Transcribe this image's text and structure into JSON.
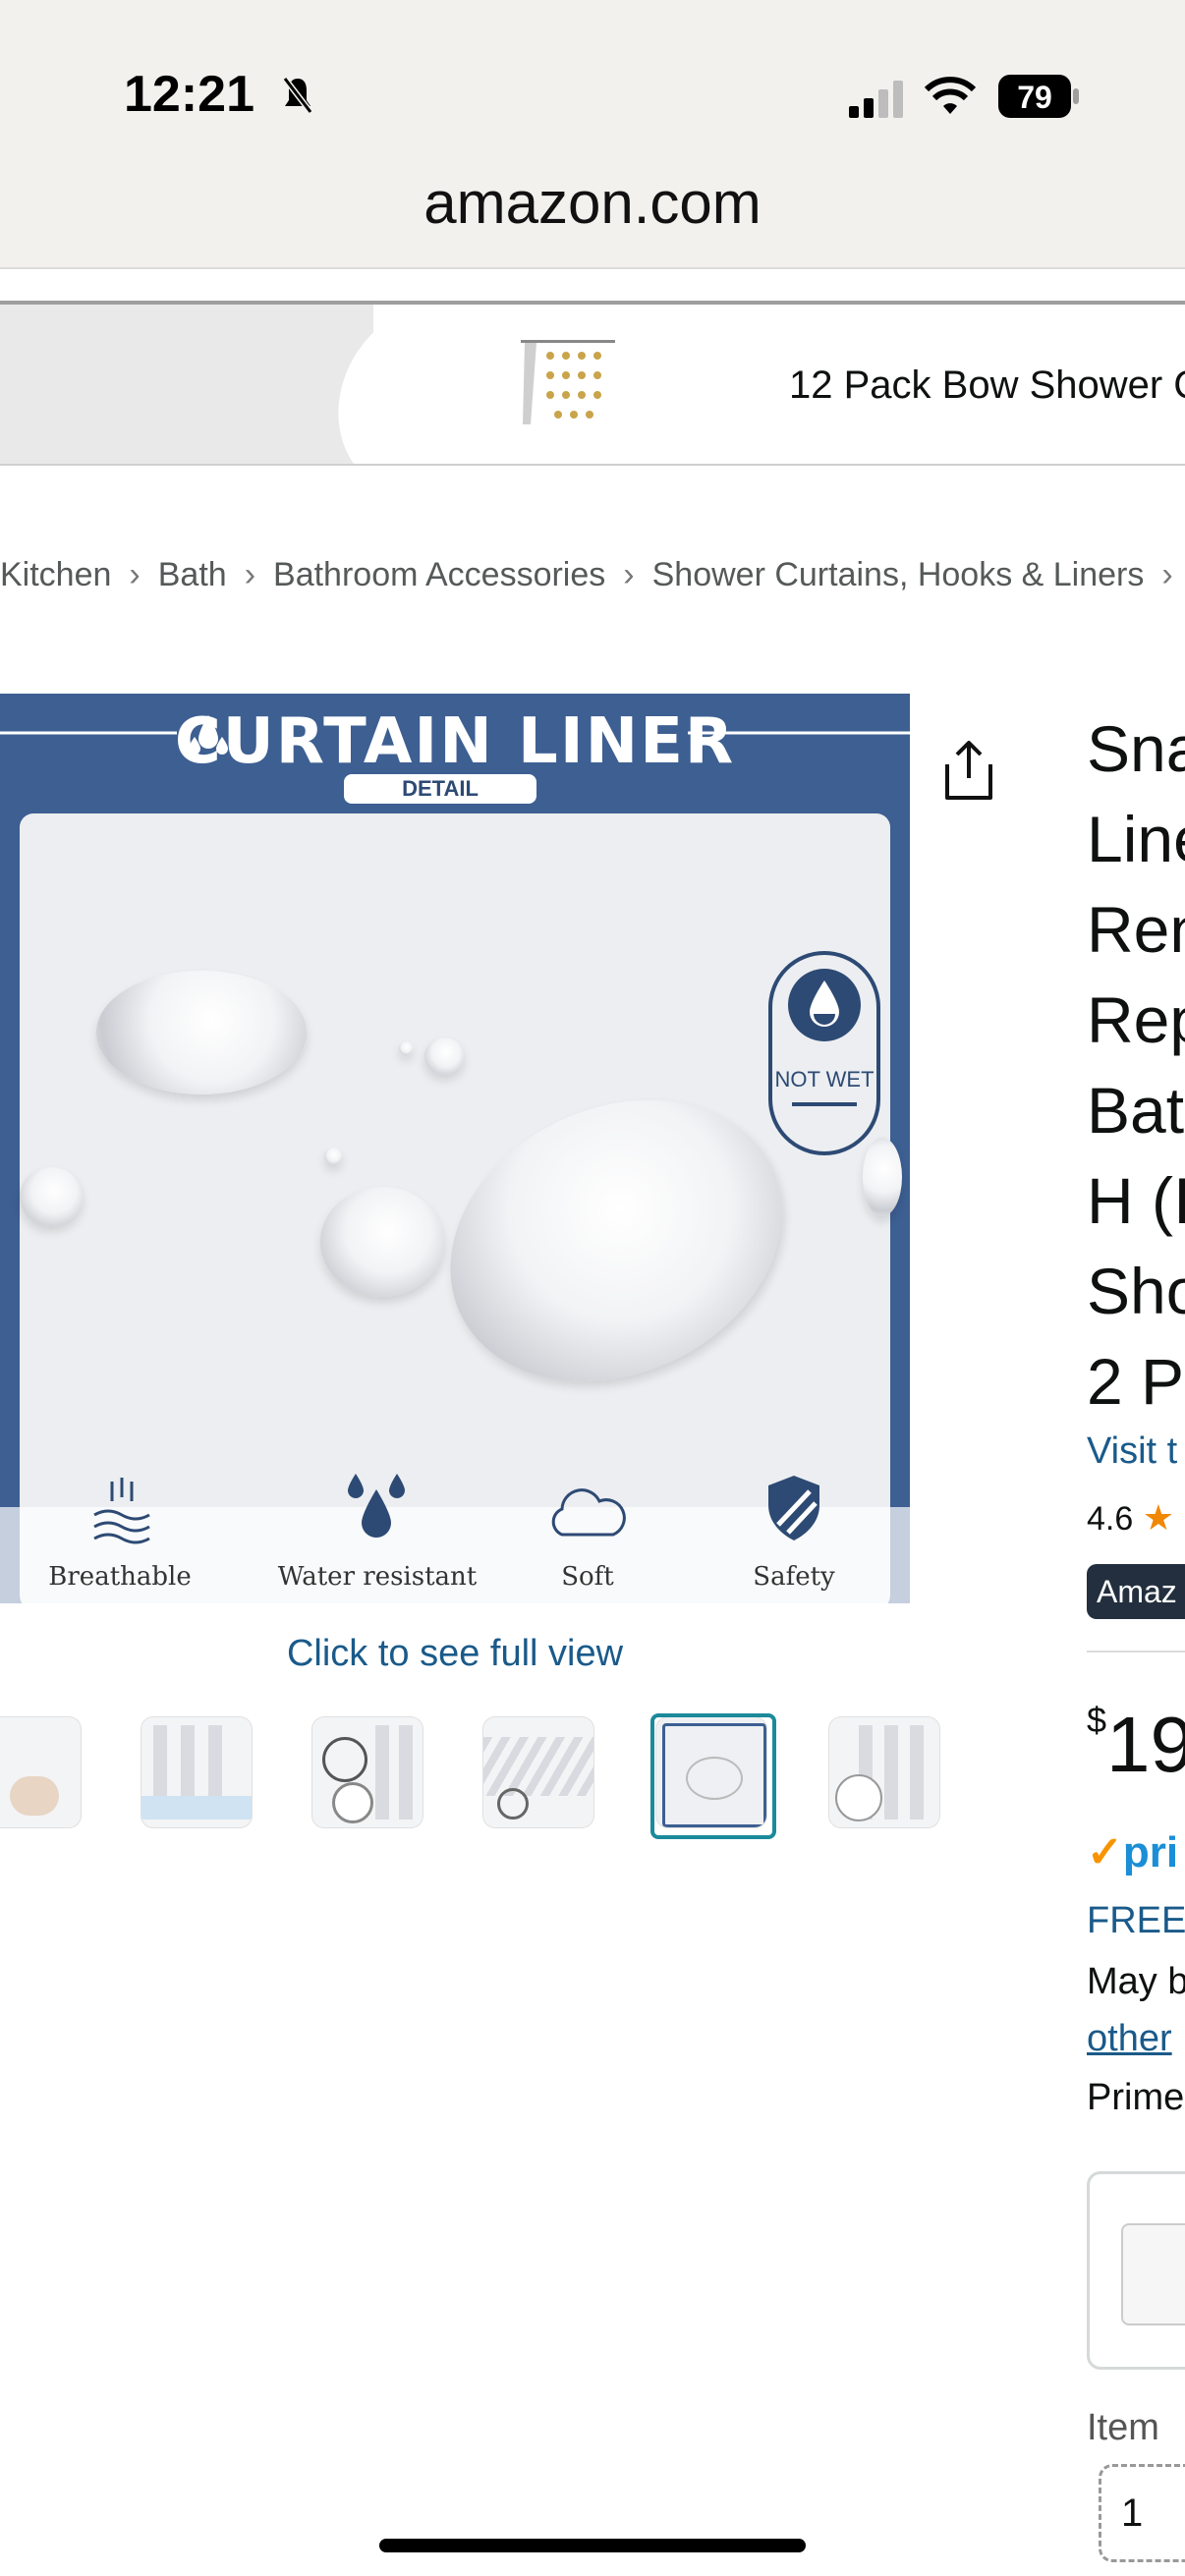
{
  "status_bar": {
    "time": "12:21",
    "battery": "79"
  },
  "browser": {
    "url": "amazon.com"
  },
  "banner": {
    "text": "12 Pack Bow Shower C"
  },
  "breadcrumb": [
    "Kitchen",
    "Bath",
    "Bathroom Accessories",
    "Shower Curtains, Hooks & Liners"
  ],
  "product_image": {
    "title": "CURTAIN LINER",
    "subtitle": "DETAIL",
    "badge": "NOT WET",
    "features": [
      "Breathable",
      "Water resistant",
      "Soft",
      "Safety"
    ],
    "full_view_link": "Click to see full view"
  },
  "thumbnails": {
    "count": 6,
    "selected_index": 4
  },
  "product": {
    "title_lines": [
      "Sna",
      "Line",
      "Ren",
      "Rep",
      "Bat",
      "H (I",
      "Sho",
      "2 P"
    ],
    "visit_store": "Visit t",
    "rating": "4.6",
    "badge": "Amaz",
    "price_symbol": "$",
    "price": "19",
    "prime": "pri",
    "free_delivery": "FREE",
    "may_be": "May b",
    "other_link": "other",
    "prime_line": "Prime",
    "item_label": "Item",
    "quantity": "1"
  },
  "colors": {
    "link": "#1a5a8a",
    "image_frame": "#3d5f92",
    "selected_thumb": "#1b8a9a",
    "prime": "#1a8ed6"
  }
}
